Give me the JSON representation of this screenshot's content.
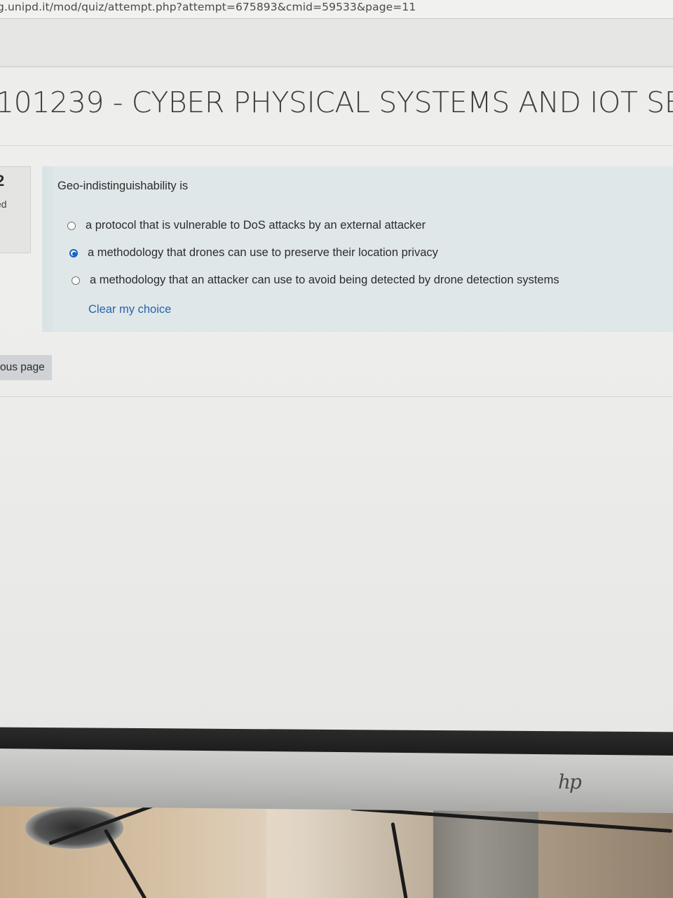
{
  "browser": {
    "url": "g.unipd.it/mod/quiz/attempt.php?attempt=675893&cmid=59533&page=11"
  },
  "course": {
    "title": "101239 - CYBER PHYSICAL SYSTEMS AND IOT SEC"
  },
  "question_info": {
    "number": "2",
    "status": "ed"
  },
  "question": {
    "text": "Geo-indistinguishability is",
    "options": [
      {
        "label": "a protocol that is vulnerable to DoS attacks by an external attacker",
        "selected": false
      },
      {
        "label": "a methodology that drones can use to preserve their location privacy",
        "selected": true
      },
      {
        "label": "a methodology that an attacker can use to avoid being detected by drone detection systems",
        "selected": false
      }
    ],
    "clear_label": "Clear my choice"
  },
  "navigation": {
    "previous_label": "ous page"
  },
  "monitor": {
    "brand": "hp"
  },
  "colors": {
    "question_bg": "#dfe7e9",
    "link": "#2a64a8",
    "radio_selected": "#1565c0"
  }
}
